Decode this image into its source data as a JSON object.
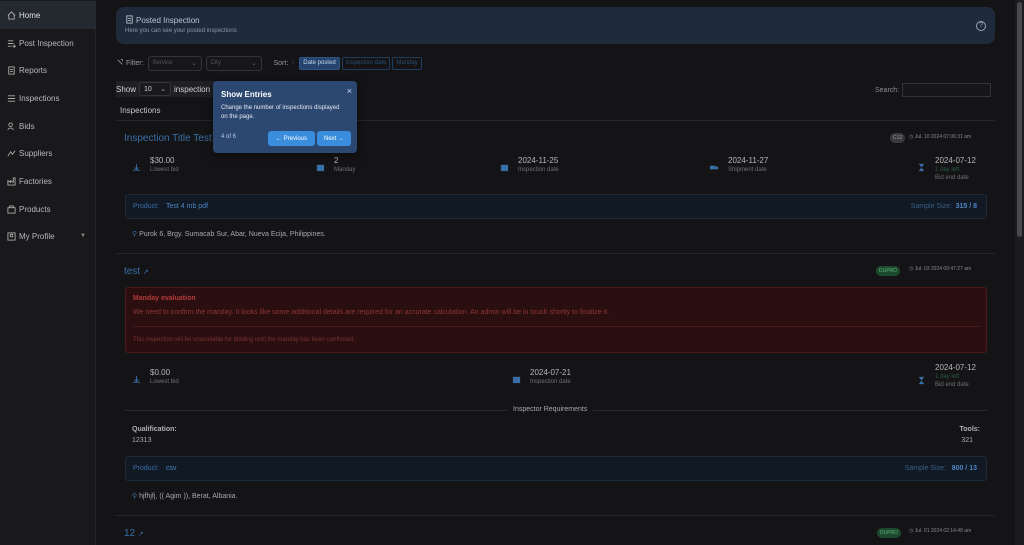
{
  "sidebar": {
    "items": [
      {
        "label": "Home",
        "icon": "home-icon"
      },
      {
        "label": "Post Inspection",
        "icon": "post-icon"
      },
      {
        "label": "Reports",
        "icon": "report-icon"
      },
      {
        "label": "Inspections",
        "icon": "list-icon"
      },
      {
        "label": "Bids",
        "icon": "bids-icon"
      },
      {
        "label": "Suppliers",
        "icon": "suppliers-icon"
      },
      {
        "label": "Factories",
        "icon": "factory-icon"
      },
      {
        "label": "Products",
        "icon": "products-icon"
      },
      {
        "label": "My Profile",
        "icon": "profile-icon"
      }
    ]
  },
  "header": {
    "title": "Posted Inspection",
    "subtitle": "Here you can see your posted inspections",
    "help": "?"
  },
  "filters": {
    "filter_label": "Filter:",
    "service_placeholder": "Service",
    "city_placeholder": "City",
    "sort_label": "Sort:",
    "sort_options": [
      "Date posted",
      "Inspection date",
      "Manday"
    ]
  },
  "list_controls": {
    "show_label": "Show",
    "entries_value": "10",
    "suffix": "inspection",
    "search_label": "Search:"
  },
  "section_label": "Inspections",
  "cards": [
    {
      "title": "Inspection Title Test",
      "badge": "C12",
      "date": "Jul. 10 2024 07:06:31 am",
      "stats": [
        {
          "value": "$30.00",
          "label": "Lowest bid"
        },
        {
          "value": "2",
          "label": "Manday"
        },
        {
          "value": "2024-11-25",
          "label": "Inspection date"
        },
        {
          "value": "2024-11-27",
          "label": "Shipment date"
        },
        {
          "value": "2024-07-12",
          "extra": "1 day left",
          "label": "Bid end date"
        }
      ],
      "product_label": "Product:",
      "product_value": "Test 4 mb pdf",
      "sample_label": "Sample Size:",
      "sample_value": "315 / 8",
      "address": "Purok 6, Brgy. Sumacab Sur, Abar, Nueva Ecija, Philippines."
    },
    {
      "title": "test",
      "badge": "DUPRO",
      "date": "Jul. 03 2024 09:47:27 am",
      "eval_title": "Manday evaluation",
      "eval_text": "We need to confirm the manday. It looks like some additional details are required for an accurate calculation. An admin will be in touch shortly to finalize it.",
      "eval_note": "This inspection will be unavailable for bidding until the manday has been confirmed.",
      "stats": [
        {
          "value": "$0.00",
          "label": "Lowest bid"
        },
        {
          "value": "2024-07-21",
          "label": "Inspection date"
        },
        {
          "value": "2024-07-12",
          "extra": "1 day left",
          "label": "Bid end date"
        }
      ],
      "req_title": "Inspector Requirements",
      "qual_label": "Qualification:",
      "qual_value": "12313",
      "tools_label": "Tools:",
      "tools_value": "321",
      "product_label": "Product:",
      "product_value": "csv",
      "sample_label": "Sample Size:",
      "sample_value": "800 / 13",
      "address": "hjfhjfj, (( Agim )), Berat, Albania."
    },
    {
      "title": "12",
      "badge": "DUPRO",
      "date": "Jul. 01 2024 02:14:48 am"
    }
  ],
  "tour": {
    "title": "Show Entries",
    "description": "Change the number of inspections displayed on the page.",
    "progress": "4 of 6",
    "prev_label": "← Previous",
    "next_label": "Next →",
    "close": "×"
  },
  "colors": {
    "accent": "#3a6ea8",
    "tour_bg": "#2c4770",
    "tour_btn": "#3a8ddc",
    "eval_bg": "#2b0f10",
    "badge_green": "#1d4a2e"
  }
}
